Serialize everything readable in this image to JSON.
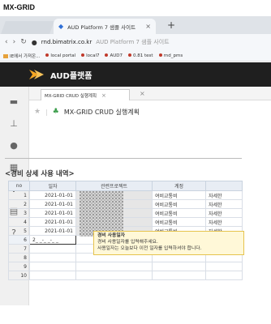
{
  "caption": "MX-GRID",
  "browser": {
    "tab_title": "AUD Platform 7 샘플 사이트",
    "tab_close": "×",
    "new_tab": "+",
    "url_host": "rnd.bimatrix.co.kr",
    "url_rest": "AUD Platform 7 샘플 사이트",
    "bookmarks": [
      {
        "label": "IE에서 가져온...",
        "kind": "folder",
        "color": "#e6a23c"
      },
      {
        "label": "local portal",
        "kind": "dot",
        "color": "#c0392b"
      },
      {
        "label": "local7",
        "kind": "dot",
        "color": "#c0392b"
      },
      {
        "label": "AUD7",
        "kind": "dot",
        "color": "#c0392b"
      },
      {
        "label": "0.81 test",
        "kind": "dot",
        "color": "#c0392b"
      },
      {
        "label": "rnd_pms",
        "kind": "dot",
        "color": "#c0392b"
      }
    ]
  },
  "app": {
    "title": "AUD플랫폼",
    "tab_label": "MX-GRID CRUD 실행계획",
    "tab_close": "×",
    "page_title": "MX-GRID CRUD 실행계획",
    "section_title": "<경비 상세 사용 내역>"
  },
  "grid": {
    "columns": [
      "no",
      "일자",
      "관련프로젝트",
      "계정",
      ""
    ],
    "rows": [
      {
        "no": "1",
        "date": "2021-01-01",
        "account": "여비교통비",
        "detail": "자세한"
      },
      {
        "no": "2",
        "date": "2021-01-01",
        "account": "여비교통비",
        "detail": "자세한"
      },
      {
        "no": "3",
        "date": "2021-01-01",
        "account": "여비교통비",
        "detail": "자세한"
      },
      {
        "no": "4",
        "date": "2021-01-01",
        "account": "여비교통비",
        "detail": "자세한"
      },
      {
        "no": "5",
        "date": "2021-01-01",
        "account": "여비교통비",
        "detail": "자세한"
      },
      {
        "no": "6",
        "date": "2_ _-_ _-_ _",
        "account": "",
        "detail": ""
      },
      {
        "no": "7",
        "date": "",
        "account": "",
        "detail": ""
      },
      {
        "no": "8",
        "date": "",
        "account": "",
        "detail": ""
      },
      {
        "no": "9",
        "date": "",
        "account": "",
        "detail": ""
      },
      {
        "no": "10",
        "date": "",
        "account": "",
        "detail": ""
      }
    ]
  },
  "tooltip": {
    "title": "경비 사용일자",
    "line1": "경비 사용일자를 입력해주세요.",
    "line2": "사용일자는 오늘보다 이전 일자를 입력하셔야 합니다."
  },
  "colors": {
    "app_header": "#1f1f1f",
    "accent_arrow": "#f5a623",
    "tooltip_bg": "#fff8d8"
  }
}
